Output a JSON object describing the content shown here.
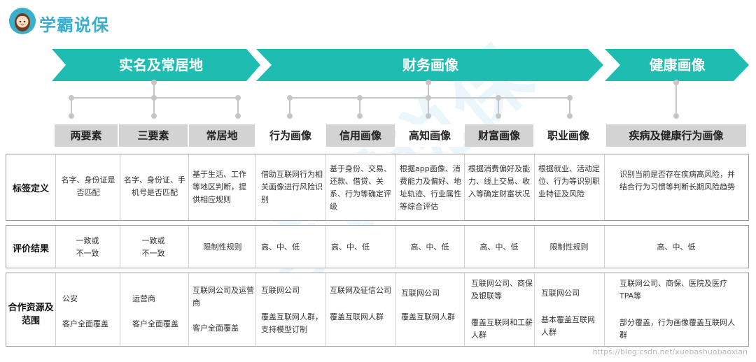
{
  "brand": {
    "name": "学霸说保"
  },
  "categories": [
    {
      "label": "实名及常居地"
    },
    {
      "label": "财务画像"
    },
    {
      "label": "健康画像"
    }
  ],
  "columns": [
    "两要素",
    "三要素",
    "常居地",
    "行为画像",
    "信用画像",
    "高知画像",
    "财富画像",
    "职业画像",
    "疾病及健康行为画像"
  ],
  "rows": [
    {
      "label": "标签定义",
      "cells": [
        "名字、身份证是否匹配",
        "名字、身份证、手机号是否匹配",
        "基于生活、工作等地区判断，提供相应规则",
        "借助互联网行为相关画像进行风险识别",
        "基于身份、交易、还款、借贷、关系、行为等确定评级",
        "根据app画像、消费能力及偏好、地址轨迹、行业属性等综合评估",
        "根据消费偏好及能力、线上交易、收入等确定财富状况",
        "根据就业、活动定位、行为等识别职业特征及风险",
        "识别当前是否存在疾病高风险，并结合行为习惯等判断长期风险趋势"
      ]
    },
    {
      "label": "评价结果",
      "cells": [
        "一致或不一致",
        "一致或不一致",
        "限制性规则",
        "高、中、低",
        "高、中、低",
        "高、中、低",
        "高、中、低",
        "限制性规则",
        "高、中、低"
      ]
    },
    {
      "label": "合作资源及范围",
      "cells": [
        [
          "公安",
          "客户全面覆盖"
        ],
        [
          "运营商",
          "客户全面覆盖"
        ],
        [
          "互联网公司及运营商",
          "客户全面覆盖"
        ],
        [
          "互联网公司",
          "覆盖互联网人群，支持模型订制"
        ],
        [
          "互联网及征信公司",
          "覆盖互联网人群"
        ],
        [
          "互联网公司",
          "覆盖互联网人群"
        ],
        [
          "互联网公司、商保及银联等",
          "覆盖互联网和工薪人群"
        ],
        [
          "互联网公司",
          "基本覆盖互联网人群"
        ],
        [
          "互联网公司、商保、医院及医疗TPA等",
          "部分覆盖，行为画像覆盖互联网人群"
        ]
      ]
    }
  ],
  "watermark": "学霸说保",
  "footer_url": "https://blog.csdn.net/xuebashuobaoxian",
  "colors": {
    "chevron": "#1fbcb1",
    "header_bg": "#d3d3d3",
    "brand": "#3aaecb"
  }
}
